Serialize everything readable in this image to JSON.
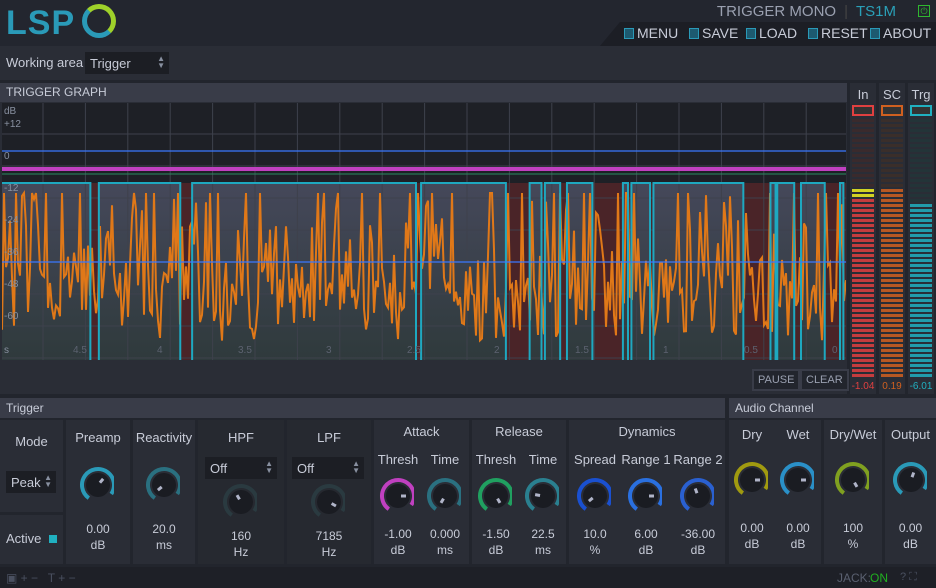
{
  "header": {
    "logo": "LSP",
    "plugin_title": "TRIGGER MONO",
    "plugin_code": "TS1M",
    "menu": [
      {
        "label": "MENU",
        "icon": "menu-icon"
      },
      {
        "label": "SAVE",
        "icon": "save-icon"
      },
      {
        "label": "LOAD",
        "icon": "load-icon"
      },
      {
        "label": "RESET",
        "icon": "reset-icon"
      },
      {
        "label": "ABOUT",
        "icon": "about-icon"
      }
    ]
  },
  "working_area": {
    "label": "Working area",
    "value": "Trigger"
  },
  "graph": {
    "title": "TRIGGER GRAPH",
    "y_unit": "dB",
    "y_labels": [
      "+12",
      "0",
      "-12",
      "-24",
      "-36",
      "-48",
      "-60"
    ],
    "x_unit": "s",
    "x_labels": [
      "4.5",
      "4",
      "3.5",
      "3",
      "2.5",
      "2",
      "1.5",
      "1",
      "0.5",
      "0"
    ],
    "trigger_pulses_s": [
      [
        4.95,
        4.42
      ],
      [
        4.37,
        3.89
      ],
      [
        3.82,
        2.5
      ],
      [
        2.47,
        1.97
      ],
      [
        1.83,
        1.76
      ],
      [
        1.74,
        1.65
      ],
      [
        1.61,
        1.46
      ],
      [
        1.28,
        1.25
      ],
      [
        1.23,
        1.12
      ],
      [
        1.1,
        0.57
      ],
      [
        0.41,
        0.38
      ],
      [
        0.37,
        0.27
      ],
      [
        0.23,
        0.09
      ],
      [
        0.0,
        -0.02
      ]
    ],
    "colors": {
      "signal": "#e07818",
      "trigger": "#1ea8c0",
      "threshold": "#3a78ff",
      "level": "#c040c0"
    },
    "pause": "PAUSE",
    "clear": "CLEAR"
  },
  "meters": [
    {
      "label": "In",
      "value": "-1.04",
      "color": "#e04040"
    },
    {
      "label": "SC",
      "value": "0.19",
      "color": "#d06020"
    },
    {
      "label": "Trg",
      "value": "-6.01",
      "color": "#20b0c0"
    }
  ],
  "trigger": {
    "title": "Trigger",
    "mode_label": "Mode",
    "mode": "Peak",
    "active_label": "Active",
    "preamp": {
      "label": "Preamp",
      "value": "0.00",
      "unit": "dB"
    },
    "reactivity": {
      "label": "Reactivity",
      "value": "20.0",
      "unit": "ms"
    },
    "hpf": {
      "label": "HPF",
      "select": "Off",
      "value": "160",
      "unit": "Hz"
    },
    "lpf": {
      "label": "LPF",
      "select": "Off",
      "value": "7185",
      "unit": "Hz"
    },
    "attack": {
      "label": "Attack",
      "thresh": {
        "label": "Thresh",
        "value": "-1.00",
        "unit": "dB"
      },
      "time": {
        "label": "Time",
        "value": "0.000",
        "unit": "ms"
      }
    },
    "release": {
      "label": "Release",
      "thresh": {
        "label": "Thresh",
        "value": "-1.50",
        "unit": "dB"
      },
      "time": {
        "label": "Time",
        "value": "22.5",
        "unit": "ms"
      }
    },
    "dynamics": {
      "label": "Dynamics",
      "spread": {
        "label": "Spread",
        "value": "10.0",
        "unit": "%"
      },
      "range1": {
        "label": "Range 1",
        "value": "6.00",
        "unit": "dB"
      },
      "range2": {
        "label": "Range 2",
        "value": "-36.00",
        "unit": "dB"
      }
    }
  },
  "audio": {
    "title": "Audio Channel",
    "dry": {
      "label": "Dry",
      "value": "0.00",
      "unit": "dB"
    },
    "wet": {
      "label": "Wet",
      "value": "0.00",
      "unit": "dB"
    },
    "drywet": {
      "label": "Dry/Wet",
      "value": "100",
      "unit": "%"
    },
    "output": {
      "label": "Output",
      "value": "0.00",
      "unit": "dB"
    }
  },
  "footer": {
    "jack_label": "JACK:",
    "jack_status": "ON"
  }
}
